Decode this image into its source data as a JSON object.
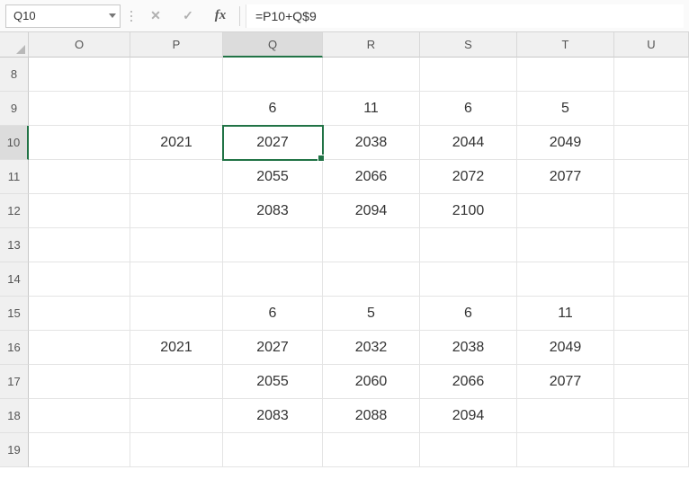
{
  "nameBox": "Q10",
  "formula": "=P10+Q$9",
  "fxLabel": "fx",
  "cancelGlyph": "✕",
  "acceptGlyph": "✓",
  "colWidths": {
    "O": 113,
    "P": 103,
    "Q": 111,
    "R": 108,
    "S": 108,
    "T": 108,
    "U": 83
  },
  "columns": [
    "O",
    "P",
    "Q",
    "R",
    "S",
    "T",
    "U"
  ],
  "rows": [
    "8",
    "9",
    "10",
    "11",
    "12",
    "13",
    "14",
    "15",
    "16",
    "17",
    "18",
    "19"
  ],
  "selectedCol": "Q",
  "selectedRow": "10",
  "cells": {
    "Q9": "6",
    "R9": "11",
    "S9": "6",
    "T9": "5",
    "P10": "2021",
    "Q10": "2027",
    "R10": "2038",
    "S10": "2044",
    "T10": "2049",
    "Q11": "2055",
    "R11": "2066",
    "S11": "2072",
    "T11": "2077",
    "Q12": "2083",
    "R12": "2094",
    "S12": "2100",
    "Q15": "6",
    "R15": "5",
    "S15": "6",
    "T15": "11",
    "P16": "2021",
    "Q16": "2027",
    "R16": "2032",
    "S16": "2038",
    "T16": "2049",
    "Q17": "2055",
    "R17": "2060",
    "S17": "2066",
    "T17": "2077",
    "Q18": "2083",
    "R18": "2088",
    "S18": "2094"
  }
}
